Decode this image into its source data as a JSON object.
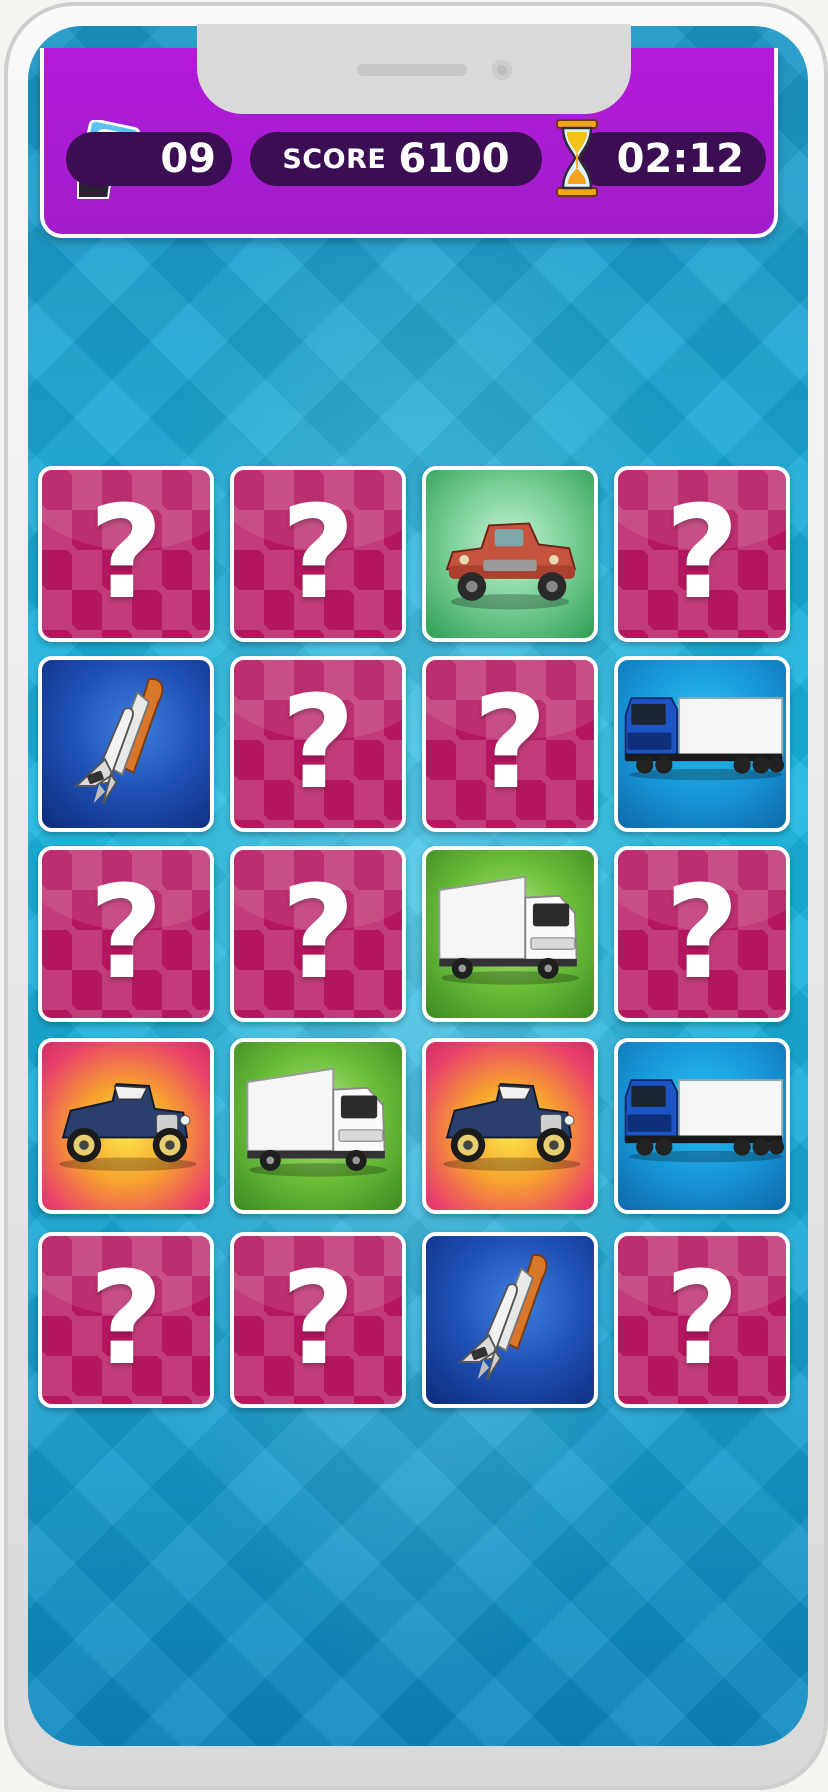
{
  "hud": {
    "moves": "09",
    "score_label": "SCORE",
    "score_value": "6100",
    "timer": "02:12",
    "icons": [
      "tap-cards-icon",
      "hourglass-icon"
    ]
  },
  "board": {
    "rows": 5,
    "cols": 4,
    "hidden_symbol": "?",
    "cards": [
      {
        "state": "hidden"
      },
      {
        "state": "hidden"
      },
      {
        "state": "revealed",
        "image": "red-pickup-truck"
      },
      {
        "state": "hidden"
      },
      {
        "state": "revealed",
        "image": "space-shuttle"
      },
      {
        "state": "hidden"
      },
      {
        "state": "hidden"
      },
      {
        "state": "revealed",
        "image": "blue-semi-truck"
      },
      {
        "state": "hidden"
      },
      {
        "state": "hidden"
      },
      {
        "state": "revealed",
        "image": "white-box-truck"
      },
      {
        "state": "hidden"
      },
      {
        "state": "revealed",
        "image": "vintage-roadster"
      },
      {
        "state": "revealed",
        "image": "white-box-truck"
      },
      {
        "state": "revealed",
        "image": "vintage-roadster"
      },
      {
        "state": "revealed",
        "image": "blue-semi-truck"
      },
      {
        "state": "hidden"
      },
      {
        "state": "hidden"
      },
      {
        "state": "revealed",
        "image": "space-shuttle"
      },
      {
        "state": "hidden"
      }
    ]
  }
}
